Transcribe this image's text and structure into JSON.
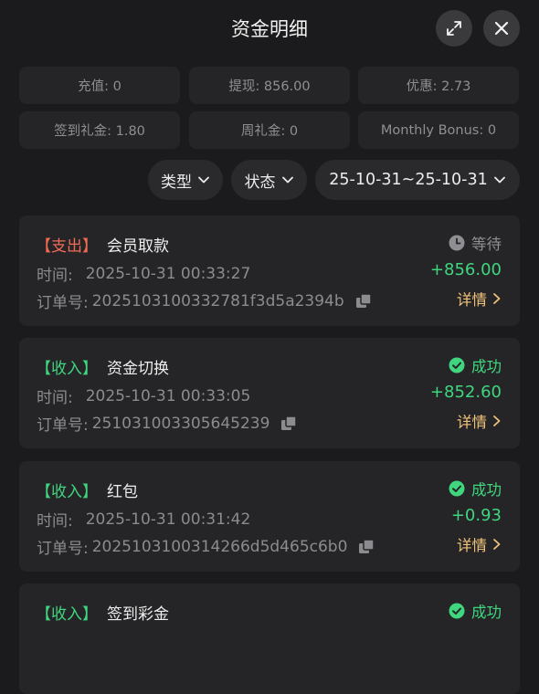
{
  "header": {
    "title": "资金明细"
  },
  "stats": [
    {
      "label": "充值: 0"
    },
    {
      "label": "提现: 856.00"
    },
    {
      "label": "优惠: 2.73"
    },
    {
      "label": "签到礼金: 1.80"
    },
    {
      "label": "周礼金: 0"
    },
    {
      "label": "Monthly Bonus: 0"
    }
  ],
  "filters": {
    "type_label": "类型",
    "status_label": "状态",
    "date_range": "25-10-31~25-10-31"
  },
  "records": [
    {
      "tag": "【支出】",
      "name": "会员取款",
      "time_label": "时间:",
      "time": "2025-10-31 00:33:27",
      "order_label": "订单号:",
      "order": "2025103100332781f3d5a2394b",
      "status": "等待",
      "amount": "+856.00",
      "detail": "详情"
    },
    {
      "tag": "【收入】",
      "name": "资金切换",
      "time_label": "时间:",
      "time": "2025-10-31 00:33:05",
      "order_label": "订单号:",
      "order": "25103100330564523​9",
      "status": "成功",
      "amount": "+852.60",
      "detail": "详情"
    },
    {
      "tag": "【收入】",
      "name": "红包",
      "time_label": "时间:",
      "time": "2025-10-31 00:31:42",
      "order_label": "订单号:",
      "order": "2025103100314266d5d465c6b0",
      "status": "成功",
      "amount": "+0.93",
      "detail": "详情"
    },
    {
      "tag": "【收入】",
      "name": "签到彩金",
      "status": "成功"
    }
  ],
  "colors": {
    "background": "#1b1b1d",
    "card": "#252527",
    "expense_tag": "#f06a55",
    "income_tag": "#3fd67f",
    "detail_link": "#f0c27a"
  }
}
